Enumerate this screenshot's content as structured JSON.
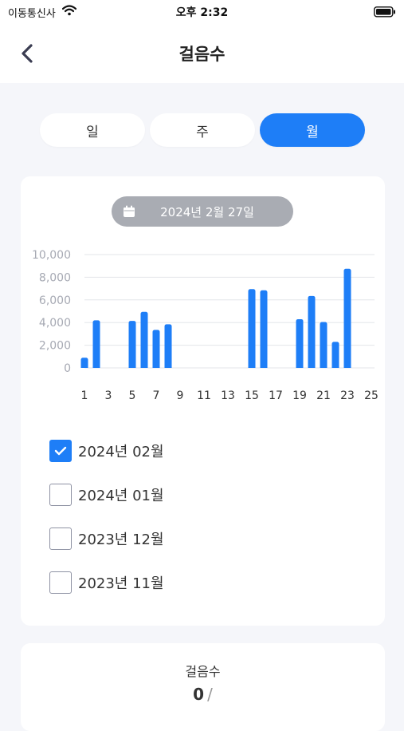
{
  "status_bar": {
    "carrier": "이동통신사",
    "time": "오후 2:32"
  },
  "nav": {
    "title": "걸음수"
  },
  "tabs": [
    {
      "label": "일",
      "active": false
    },
    {
      "label": "주",
      "active": false
    },
    {
      "label": "월",
      "active": true
    }
  ],
  "date_pill": {
    "label": "2024년 2월 27일"
  },
  "chart_data": {
    "type": "bar",
    "x": [
      1,
      2,
      5,
      6,
      7,
      8,
      15,
      16,
      19,
      20,
      21,
      22,
      23
    ],
    "values": [
      900,
      4200,
      4150,
      4950,
      3350,
      3850,
      6950,
      6850,
      4300,
      6350,
      4050,
      2300,
      8750
    ],
    "x_ticks": [
      "1",
      "3",
      "5",
      "7",
      "9",
      "11",
      "13",
      "15",
      "17",
      "19",
      "21",
      "23",
      "25"
    ],
    "y_ticks": [
      "0",
      "2,000",
      "4,000",
      "6,000",
      "8,000",
      "10,000"
    ],
    "ylim": [
      0,
      10000
    ],
    "xlim": [
      1,
      25
    ],
    "grid": true,
    "colors": {
      "bar": "#1e7ef7",
      "grid": "#e3e5ea",
      "axis_text": "#a6a9b3"
    }
  },
  "months": [
    {
      "label": "2024년 02월",
      "checked": true
    },
    {
      "label": "2024년 01월",
      "checked": false
    },
    {
      "label": "2023년 12월",
      "checked": false
    },
    {
      "label": "2023년 11월",
      "checked": false
    }
  ],
  "summary": {
    "title": "걸음수",
    "value": "0",
    "separator": "/"
  },
  "colors": {
    "accent": "#1e7ef7",
    "background": "#f5f6fa",
    "pill": "#a9acb3"
  }
}
